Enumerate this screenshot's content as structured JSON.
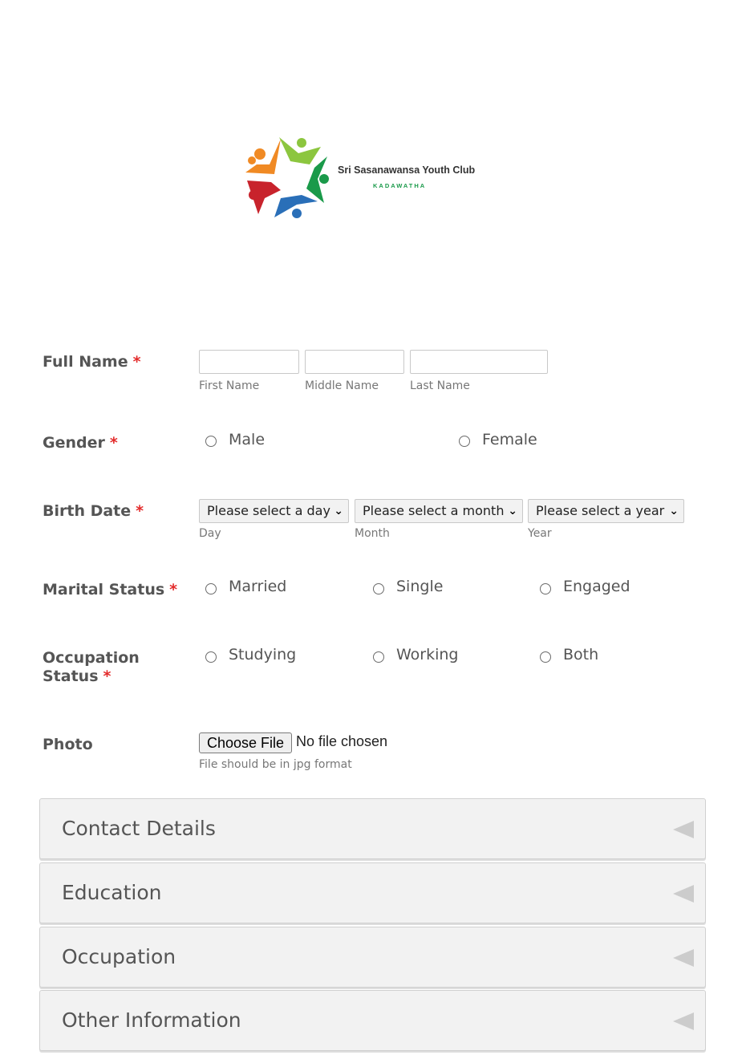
{
  "header": {
    "club_name": "Sri Sasanawansa Youth Club",
    "club_location": "KADAWATHA",
    "logo_icon": "star-people-logo-icon"
  },
  "required_marker": "*",
  "full_name": {
    "label": "Full Name",
    "first_value": "",
    "middle_value": "",
    "last_value": "",
    "first_sublabel": "First Name",
    "middle_sublabel": "Middle Name",
    "last_sublabel": "Last Name"
  },
  "gender": {
    "label": "Gender",
    "options": [
      "Male",
      "Female"
    ]
  },
  "birth_date": {
    "label": "Birth Date",
    "day_selected": "Please select a day",
    "month_selected": "Please select a month",
    "year_selected": "Please select a year",
    "day_sublabel": "Day",
    "month_sublabel": "Month",
    "year_sublabel": "Year"
  },
  "marital_status": {
    "label": "Marital Status",
    "options": [
      "Married",
      "Single",
      "Engaged"
    ]
  },
  "occupation_status": {
    "label_line1": "Occupation",
    "label_line2": "Status",
    "options": [
      "Studying",
      "Working",
      "Both"
    ]
  },
  "photo": {
    "label": "Photo",
    "button_label": "Choose File",
    "status": "No file chosen",
    "hint": "File should be in jpg format"
  },
  "sections": [
    "Contact Details",
    "Education",
    "Occupation",
    "Other Information"
  ],
  "colors": {
    "required": "#e32b2b",
    "section_bg": "#f2f2f2",
    "label_text": "#555555",
    "logo_green": "#1a9a4a"
  }
}
